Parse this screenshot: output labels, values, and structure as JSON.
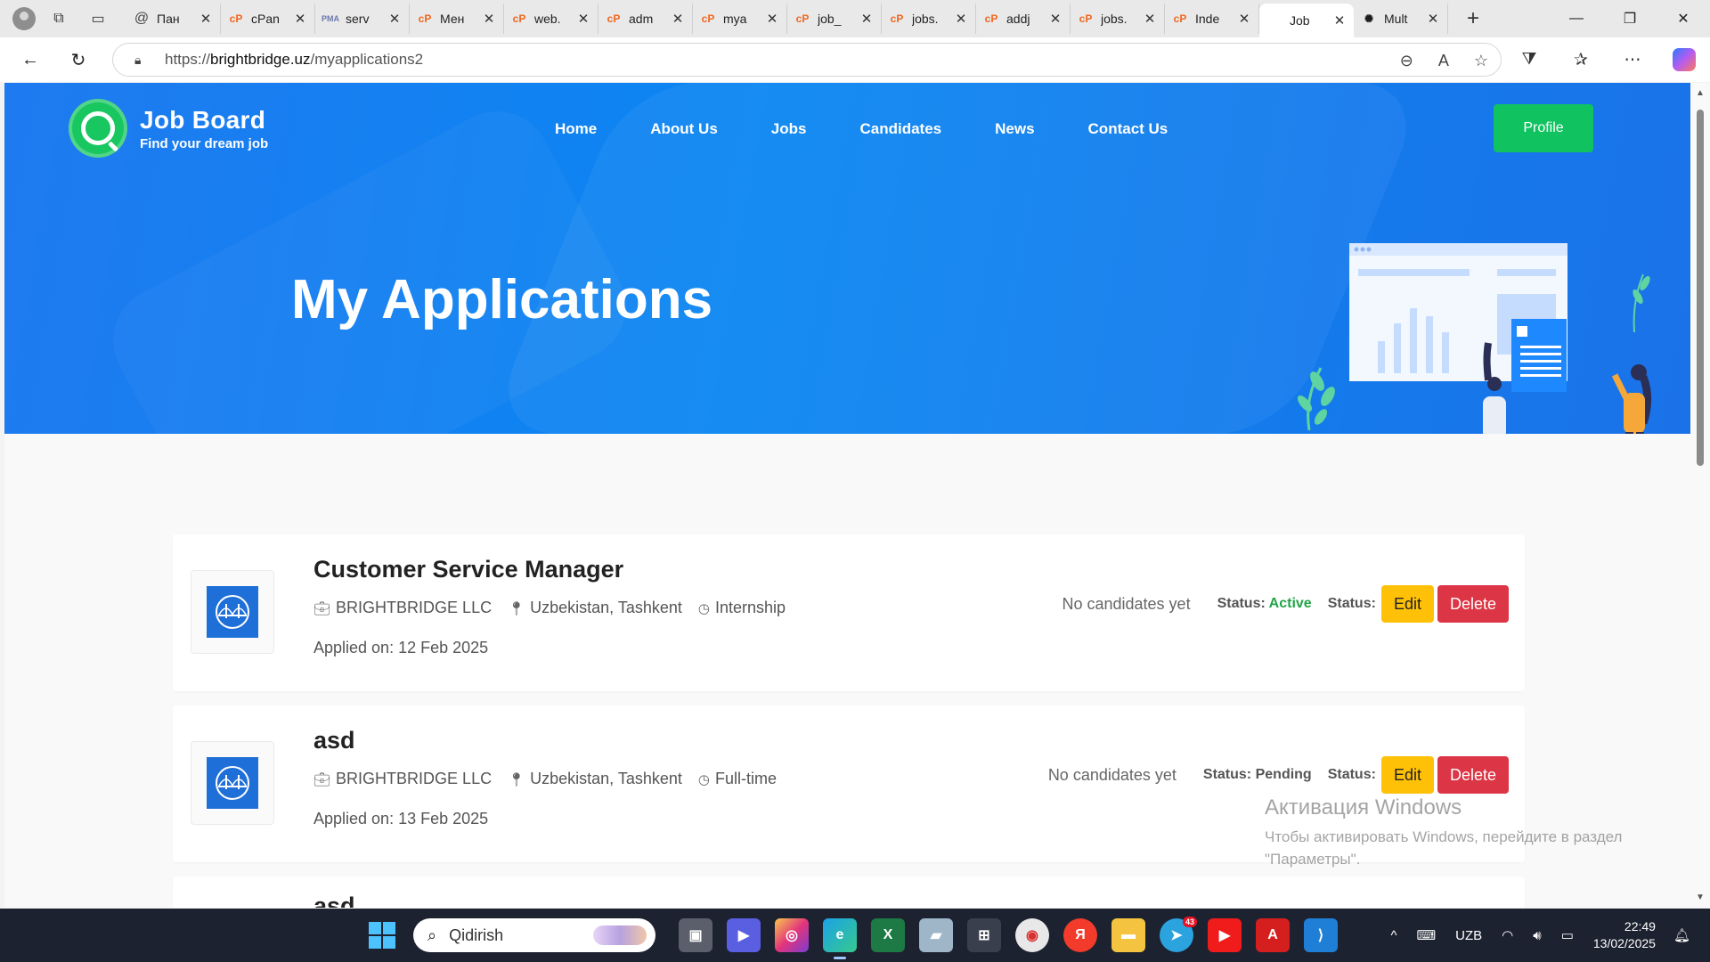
{
  "browser": {
    "tabs": [
      {
        "title": "Пан",
        "icon": "at-icon"
      },
      {
        "title": "cPan",
        "icon": "cpanel-icon"
      },
      {
        "title": "serv",
        "icon": "phpmyadmin-icon"
      },
      {
        "title": "Мен",
        "icon": "cpanel-icon"
      },
      {
        "title": "web.",
        "icon": "cpanel-icon"
      },
      {
        "title": "adm",
        "icon": "cpanel-icon"
      },
      {
        "title": "mya",
        "icon": "cpanel-icon"
      },
      {
        "title": "job_",
        "icon": "cpanel-icon"
      },
      {
        "title": "jobs.",
        "icon": "cpanel-icon"
      },
      {
        "title": "addj",
        "icon": "cpanel-icon"
      },
      {
        "title": "jobs.",
        "icon": "cpanel-icon"
      },
      {
        "title": "Inde",
        "icon": "cpanel-icon"
      },
      {
        "title": "Job",
        "icon": "blank-icon",
        "active": true
      },
      {
        "title": "Mult",
        "icon": "openai-icon"
      }
    ],
    "url_prefix": "https://",
    "url_host": "brightbridge.uz",
    "url_path": "/myapplications2"
  },
  "site": {
    "logo_title": "Job Board",
    "logo_subtitle": "Find your dream job",
    "menu": [
      "Home",
      "About Us",
      "Jobs",
      "Candidates",
      "News",
      "Contact Us"
    ],
    "profile_label": "Profile",
    "page_title": "My Applications"
  },
  "applications": [
    {
      "title": "Customer Service Manager",
      "company": "BRIGHTBRIDGE LLC",
      "location": "Uzbekistan, Tashkent",
      "type": "Internship",
      "applied": "Applied on: 12 Feb 2025",
      "candidates": "No candidates yet",
      "status_label": "Status:",
      "status_value": "Active",
      "status_label2": "Status:",
      "edit_label": "Edit",
      "delete_label": "Delete"
    },
    {
      "title": "asd",
      "company": "BRIGHTBRIDGE LLC",
      "location": "Uzbekistan, Tashkent",
      "type": "Full-time",
      "applied": "Applied on: 13 Feb 2025",
      "candidates": "No candidates yet",
      "status_label": "Status:",
      "status_value": "Pending",
      "status_label2": "Status:",
      "edit_label": "Edit",
      "delete_label": "Delete"
    },
    {
      "title": "asd"
    }
  ],
  "watermark": {
    "title": "Активация Windows",
    "line1": "Чтобы активировать Windows, перейдите в раздел",
    "line2": "\"Параметры\"."
  },
  "taskbar": {
    "search_placeholder": "Qidirish",
    "telegram_badge": "43",
    "language": "UZB",
    "time": "22:49",
    "date": "13/02/2025"
  },
  "colors": {
    "hero_blue": "#0a86f2",
    "profile_green": "#10c260",
    "edit_yellow": "#ffc107",
    "delete_red": "#dc3545",
    "active_green": "#22a447"
  }
}
